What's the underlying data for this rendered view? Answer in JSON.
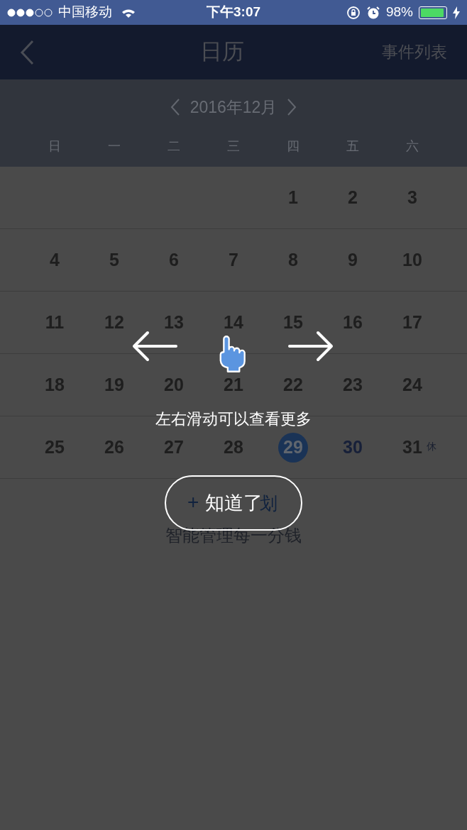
{
  "status_bar": {
    "carrier": "中国移动",
    "time": "下午3:07",
    "battery": "98%"
  },
  "nav": {
    "title": "日历",
    "action": "事件列表"
  },
  "calendar": {
    "month": "2016年12月",
    "weekdays": [
      "日",
      "一",
      "二",
      "三",
      "四",
      "五",
      "六"
    ],
    "weeks": [
      [
        {
          "kind": "blank"
        },
        {
          "kind": "blank"
        },
        {
          "kind": "blank"
        },
        {
          "kind": "blank"
        },
        {
          "kind": "day",
          "text": "1",
          "selected": false,
          "today": false
        },
        {
          "kind": "day",
          "text": "2",
          "selected": false,
          "today": false
        },
        {
          "kind": "day",
          "text": "3",
          "selected": false,
          "today": false
        }
      ],
      [
        {
          "kind": "day",
          "text": "4",
          "selected": false,
          "today": false
        },
        {
          "kind": "day",
          "text": "5",
          "selected": false,
          "today": false
        },
        {
          "kind": "day",
          "text": "6",
          "selected": false,
          "today": false
        },
        {
          "kind": "day",
          "text": "7",
          "selected": false,
          "today": false
        },
        {
          "kind": "day",
          "text": "8",
          "selected": false,
          "today": false
        },
        {
          "kind": "day",
          "text": "9",
          "selected": false,
          "today": false
        },
        {
          "kind": "day",
          "text": "10",
          "selected": false,
          "today": false
        }
      ],
      [
        {
          "kind": "day",
          "text": "11",
          "selected": false,
          "today": false
        },
        {
          "kind": "day",
          "text": "12",
          "selected": false,
          "today": false
        },
        {
          "kind": "day",
          "text": "13",
          "selected": false,
          "today": false
        },
        {
          "kind": "day",
          "text": "14",
          "selected": false,
          "today": false
        },
        {
          "kind": "day",
          "text": "15",
          "selected": false,
          "today": false
        },
        {
          "kind": "day",
          "text": "16",
          "selected": false,
          "today": false
        },
        {
          "kind": "day",
          "text": "17",
          "selected": false,
          "today": false
        }
      ],
      [
        {
          "kind": "day",
          "text": "18",
          "selected": false,
          "today": false
        },
        {
          "kind": "day",
          "text": "19",
          "selected": false,
          "today": false
        },
        {
          "kind": "day",
          "text": "20",
          "selected": false,
          "today": false
        },
        {
          "kind": "day",
          "text": "21",
          "selected": false,
          "today": false
        },
        {
          "kind": "day",
          "text": "22",
          "selected": false,
          "today": false
        },
        {
          "kind": "day",
          "text": "23",
          "selected": false,
          "today": false
        },
        {
          "kind": "day",
          "text": "24",
          "selected": false,
          "today": false
        }
      ],
      [
        {
          "kind": "day",
          "text": "25",
          "selected": false,
          "today": false
        },
        {
          "kind": "day",
          "text": "26",
          "selected": false,
          "today": false
        },
        {
          "kind": "day",
          "text": "27",
          "selected": false,
          "today": false
        },
        {
          "kind": "day",
          "text": "28",
          "selected": false,
          "today": false
        },
        {
          "kind": "day",
          "text": "29",
          "selected": true,
          "today": false
        },
        {
          "kind": "day",
          "text": "30",
          "selected": false,
          "today": true
        },
        {
          "kind": "day",
          "text": "31",
          "selected": false,
          "today": false,
          "tag": "休"
        }
      ]
    ]
  },
  "add_plan": {
    "visible_start": "+",
    "visible_end": "划",
    "subtitle": "智能管理每一分钱"
  },
  "guide": {
    "hint": "左右滑动可以查看更多",
    "button": "知道了"
  }
}
